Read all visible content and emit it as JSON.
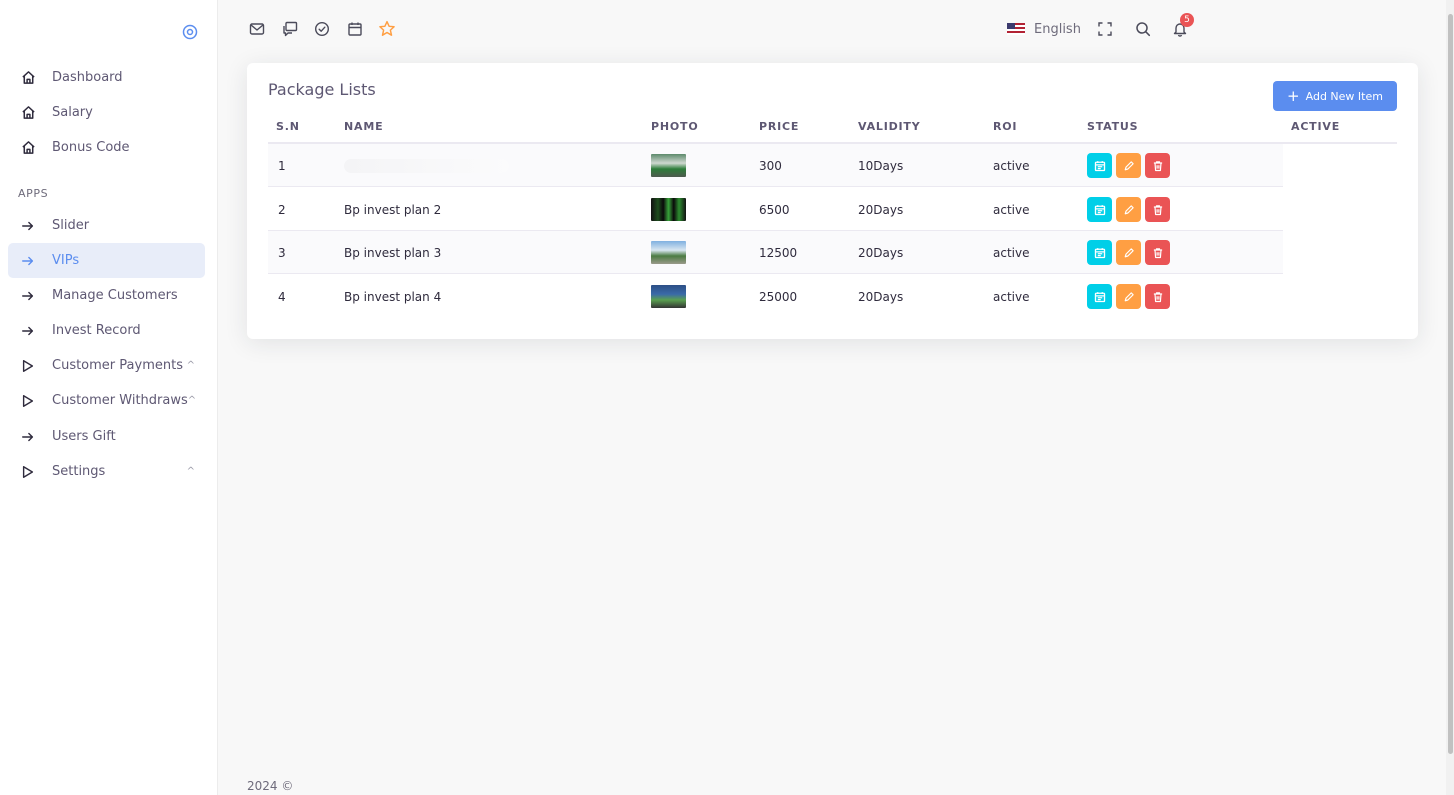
{
  "sidebar": {
    "items_top": [
      {
        "label": "Dashboard",
        "icon": "home-icon"
      },
      {
        "label": "Salary",
        "icon": "home-icon"
      },
      {
        "label": "Bonus Code",
        "icon": "home-icon"
      }
    ],
    "section_header": "APPS",
    "items_apps": [
      {
        "label": "Slider",
        "icon": "arrow-right-icon"
      },
      {
        "label": "VIPs",
        "icon": "arrow-right-icon",
        "active": true
      },
      {
        "label": "Manage Customers",
        "icon": "arrow-right-icon"
      },
      {
        "label": "Invest Record",
        "icon": "arrow-right-icon"
      },
      {
        "label": "Customer Payments",
        "icon": "play-outline-icon",
        "caret": "^"
      },
      {
        "label": "Customer Withdraws",
        "icon": "play-outline-icon",
        "caret": "^"
      },
      {
        "label": "Users Gift",
        "icon": "arrow-right-icon"
      },
      {
        "label": "Settings",
        "icon": "play-outline-icon",
        "caret": "^"
      }
    ]
  },
  "topbar": {
    "bookmark_icons": [
      "mail-icon",
      "chat-icon",
      "check-circle-icon",
      "calendar-icon",
      "star-icon"
    ],
    "language": "English",
    "notification_count": "5"
  },
  "card": {
    "title": "Package Lists",
    "add_button": "Add New Item",
    "columns": [
      "S.N",
      "NAME",
      "PHOTO",
      "PRICE",
      "VALIDITY",
      "ROI",
      "STATUS",
      "ACTIVE"
    ],
    "rows": [
      {
        "sn": "1",
        "name": "",
        "price": "300",
        "validity": "10Days",
        "roi": "active"
      },
      {
        "sn": "2",
        "name": "Bp invest plan 2",
        "price": "6500",
        "validity": "20Days",
        "roi": "active"
      },
      {
        "sn": "3",
        "name": "Bp invest plan 3",
        "price": "12500",
        "validity": "20Days",
        "roi": "active"
      },
      {
        "sn": "4",
        "name": "Bp invest plan 4",
        "price": "25000",
        "validity": "20Days",
        "roi": "active"
      }
    ]
  },
  "footer": {
    "text": "2024 ©"
  },
  "colors": {
    "accent": "#5b8def",
    "view": "#00cfe8",
    "edit": "#ff9f43",
    "delete": "#ea5455"
  }
}
